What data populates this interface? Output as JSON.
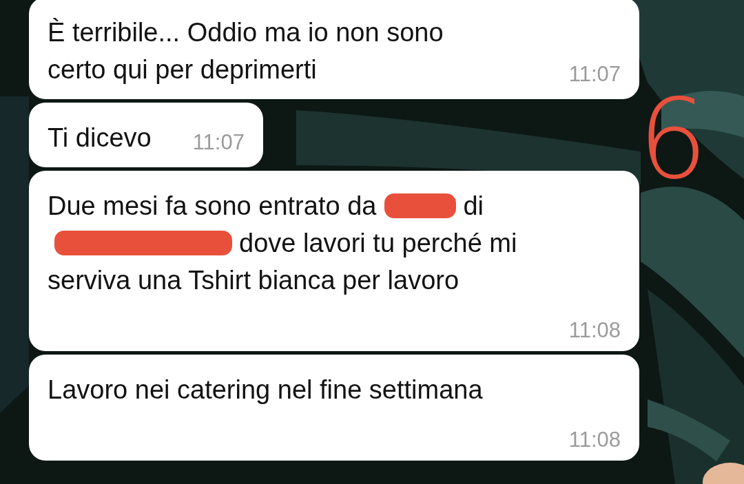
{
  "annotation": "6",
  "messages": [
    {
      "kind": "compact",
      "lines": [
        [
          {
            "kind": "text",
            "text": "È terribile... Oddio ma io non sono"
          }
        ],
        [
          {
            "kind": "text",
            "text": "certo qui per deprimerti"
          }
        ]
      ],
      "time": "11:07"
    },
    {
      "kind": "compact",
      "lines": [
        [
          {
            "kind": "text",
            "text": "Ti dicevo"
          }
        ]
      ],
      "time": "11:07"
    },
    {
      "kind": "tall",
      "lines": [
        [
          {
            "kind": "text",
            "text": "Due mesi fa sono entrato da"
          },
          {
            "kind": "blot"
          },
          {
            "kind": "text",
            "text": "di"
          }
        ],
        [
          {
            "kind": "bar"
          },
          {
            "kind": "text",
            "text": "dove lavori tu perché mi"
          }
        ],
        [
          {
            "kind": "text",
            "text": "serviva una Tshirt bianca per lavoro"
          }
        ]
      ],
      "time": "11:08"
    },
    {
      "kind": "tall",
      "lines": [
        [
          {
            "kind": "text",
            "text": "Lavoro nei catering nel fine settimana"
          }
        ]
      ],
      "time": "11:08"
    }
  ]
}
